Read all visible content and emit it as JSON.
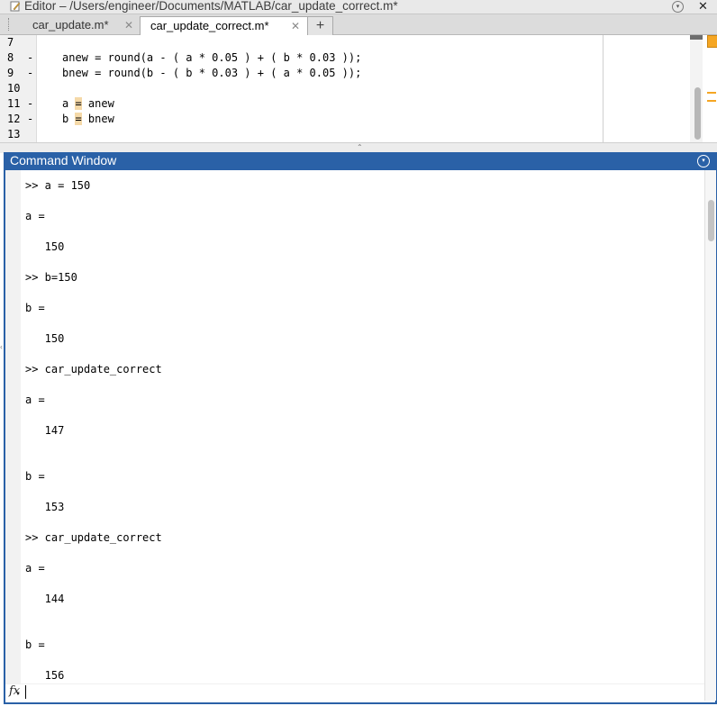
{
  "window": {
    "title": "Editor – /Users/engineer/Documents/MATLAB/car_update_correct.m*",
    "close_glyph": "✕",
    "menu_glyph": "▾"
  },
  "tabs": [
    {
      "label": "car_update.m*",
      "close": "✕",
      "active": false
    },
    {
      "label": "car_update_correct.m*",
      "close": "✕",
      "active": true
    }
  ],
  "add_tab_label": "+",
  "editor": {
    "lines": [
      {
        "num": "7",
        "dash": "",
        "code": ""
      },
      {
        "num": "8",
        "dash": "-",
        "code": "anew = round(a - ( a * 0.05 ) + ( b * 0.03 ));"
      },
      {
        "num": "9",
        "dash": "-",
        "code": "bnew = round(b - ( b * 0.03 ) + ( a * 0.05 ));"
      },
      {
        "num": "10",
        "dash": "",
        "code": ""
      },
      {
        "num": "11",
        "dash": "-",
        "code_pre": "a ",
        "code_hl": "=",
        "code_post": " anew"
      },
      {
        "num": "12",
        "dash": "-",
        "code_pre": "b ",
        "code_hl": "=",
        "code_post": " bnew"
      },
      {
        "num": "13",
        "dash": "",
        "code": ""
      }
    ],
    "warning_color": "#f5a623"
  },
  "command_window": {
    "title": "Command Window",
    "accent_color": "#2a61a7",
    "lines": [
      ">> a = 150",
      "a =",
      "   150",
      ">> b=150",
      "b =",
      "   150",
      ">> car_update_correct",
      "a =",
      "   147",
      "b =",
      "   153",
      ">> car_update_correct",
      "a =",
      "   144",
      "b =",
      "   156"
    ],
    "prompt_icon": "fx"
  }
}
